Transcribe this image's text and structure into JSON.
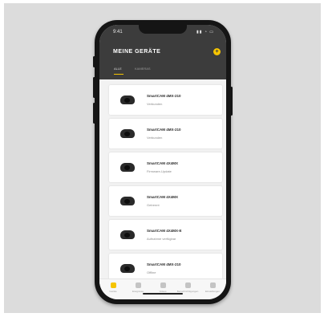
{
  "status_bar": {
    "time": "9:41",
    "icons": "▮▮ ◔ ▭"
  },
  "header": {
    "title": "MEINE GERÄTE",
    "add_icon": "+",
    "accent": "#f5c400"
  },
  "tabs": [
    {
      "label": "ALLE"
    },
    {
      "label": "KAMERAS"
    }
  ],
  "devices": [
    {
      "name": "SmartCAM 4MX-210",
      "status": "Verbunden"
    },
    {
      "name": "SmartCAM 4MX-210",
      "status": "Verbunden"
    },
    {
      "name": "SmartCAM 4X4MX",
      "status": "Firmware-Update"
    },
    {
      "name": "SmartCAM 4X4MX",
      "status": "Getrennt"
    },
    {
      "name": "SmartCAM 4X4MX-E",
      "status": "Aufnahme verfügbar"
    },
    {
      "name": "SmartCAM 4MX-210",
      "status": "Offline"
    }
  ],
  "nav": [
    {
      "label": "Geräte",
      "icon": "home-icon"
    },
    {
      "label": "Ereignisse",
      "icon": "events-icon"
    },
    {
      "label": "Videos",
      "icon": "video-icon"
    },
    {
      "label": "Benachrichtigungen",
      "icon": "bell-icon"
    },
    {
      "label": "Einstellungen",
      "icon": "gear-icon"
    }
  ]
}
